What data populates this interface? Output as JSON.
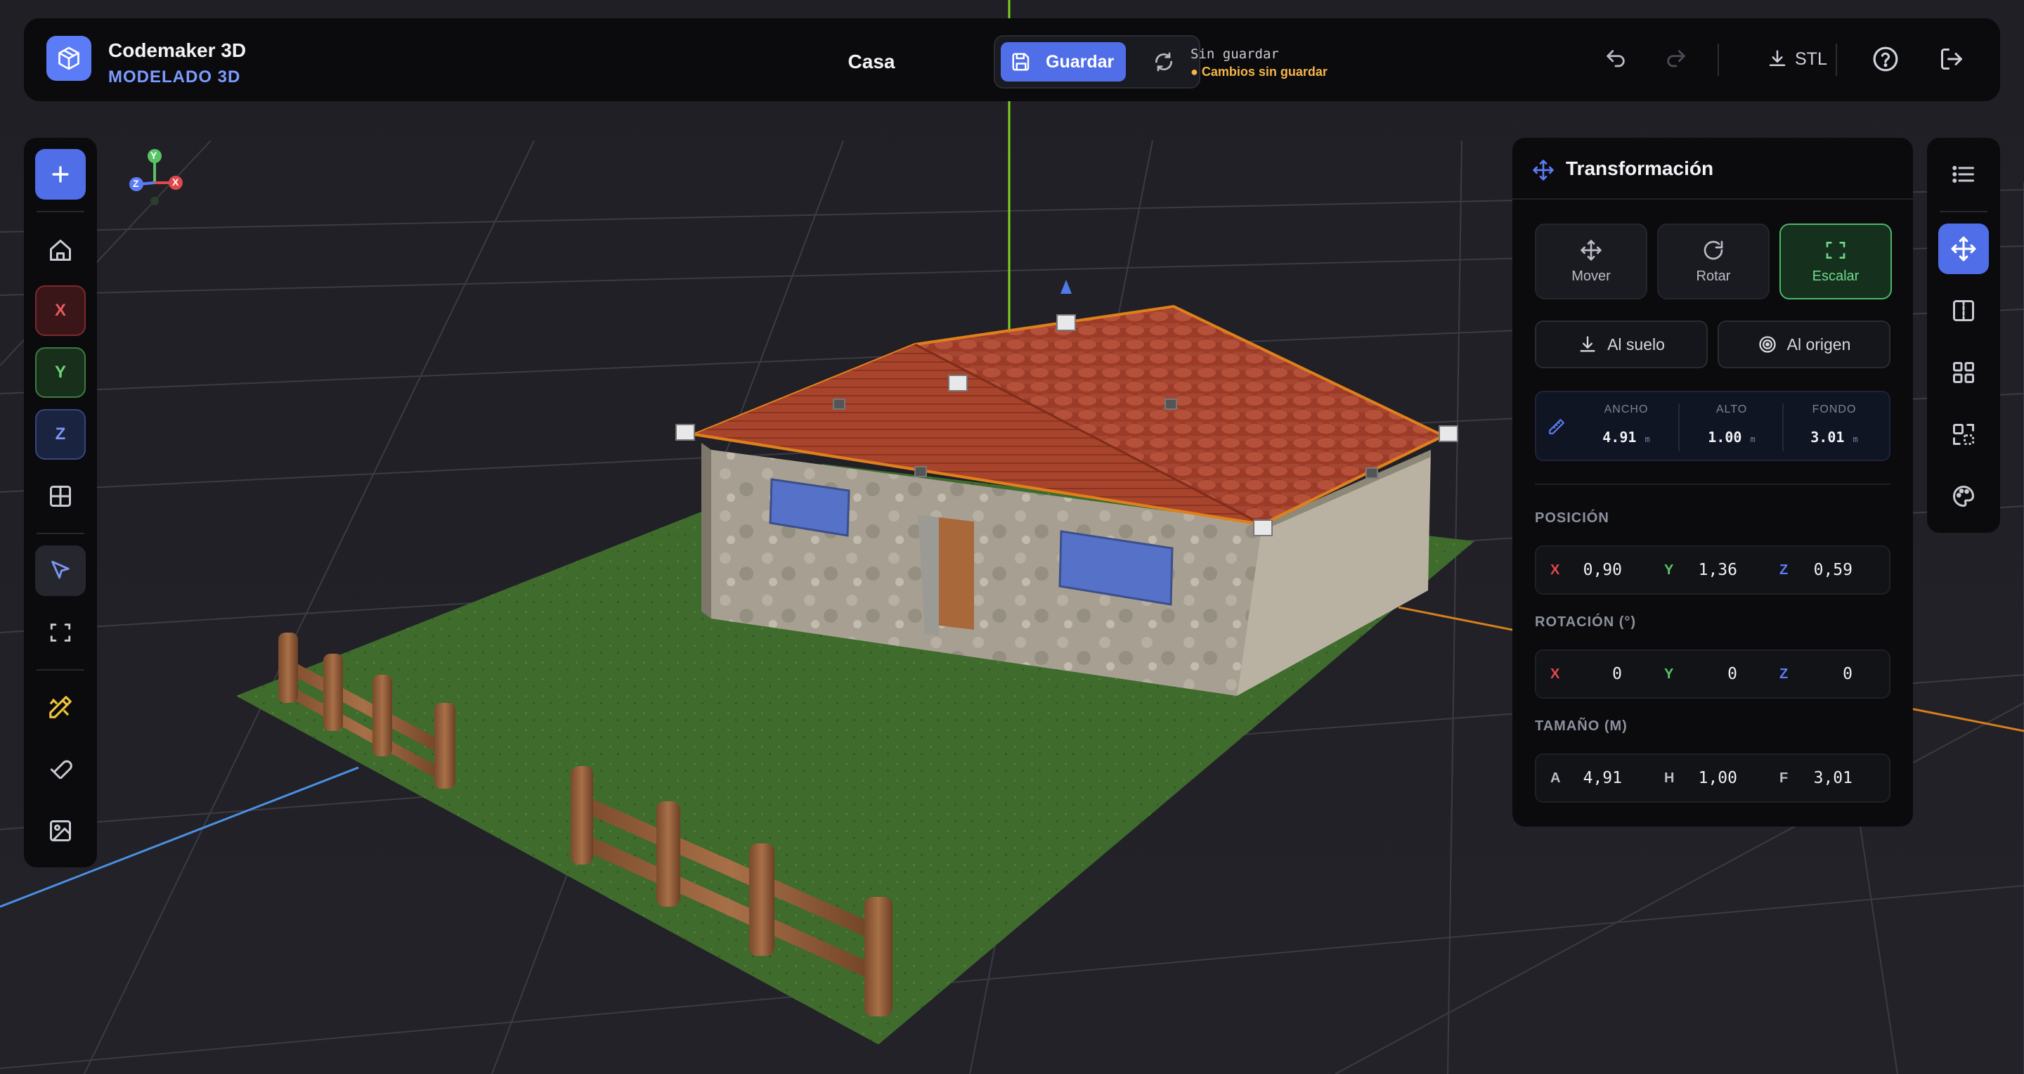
{
  "app": {
    "name": "Codemaker 3D",
    "mode": "MODELADO 3D",
    "document_title": "Casa",
    "save_label": "Guardar",
    "save_status": "Sin guardar",
    "unsaved_warning": "● Cambios sin guardar",
    "export_label": "STL"
  },
  "left_toolbar": {
    "axis_x": "X",
    "axis_y": "Y",
    "axis_z": "Z"
  },
  "panel": {
    "title": "Transformación",
    "modes": [
      {
        "label": "Mover"
      },
      {
        "label": "Rotar"
      },
      {
        "label": "Escalar",
        "active": true
      }
    ],
    "actions": {
      "floor": "Al suelo",
      "origin": "Al origen"
    },
    "dimensions": {
      "width_label": "ANCHO",
      "width_value": "4.91",
      "height_label": "ALTO",
      "height_value": "1.00",
      "depth_label": "FONDO",
      "depth_value": "3.01",
      "unit": "m"
    },
    "position": {
      "label": "POSICIÓN",
      "x_label": "X",
      "x": "0,90",
      "y_label": "Y",
      "y": "1,36",
      "z_label": "Z",
      "z": "0,59"
    },
    "rotation": {
      "label": "ROTACIÓN (°)",
      "x_label": "X",
      "x": "0",
      "y_label": "Y",
      "y": "0",
      "z_label": "Z",
      "z": "0"
    },
    "size": {
      "label": "TAMAÑO (M)",
      "a_label": "A",
      "a": "4,91",
      "h_label": "H",
      "h": "1,00",
      "f_label": "F",
      "f": "3,01"
    }
  },
  "gizmo": {
    "x": "X",
    "y": "Y",
    "z": "Z"
  },
  "colors": {
    "accent": "#4f6ee8",
    "axis_x": "#e0484c",
    "axis_y": "#58c466",
    "axis_z": "#5b7cf6",
    "warning": "#f5b547",
    "active_mode": "#4bb768"
  }
}
